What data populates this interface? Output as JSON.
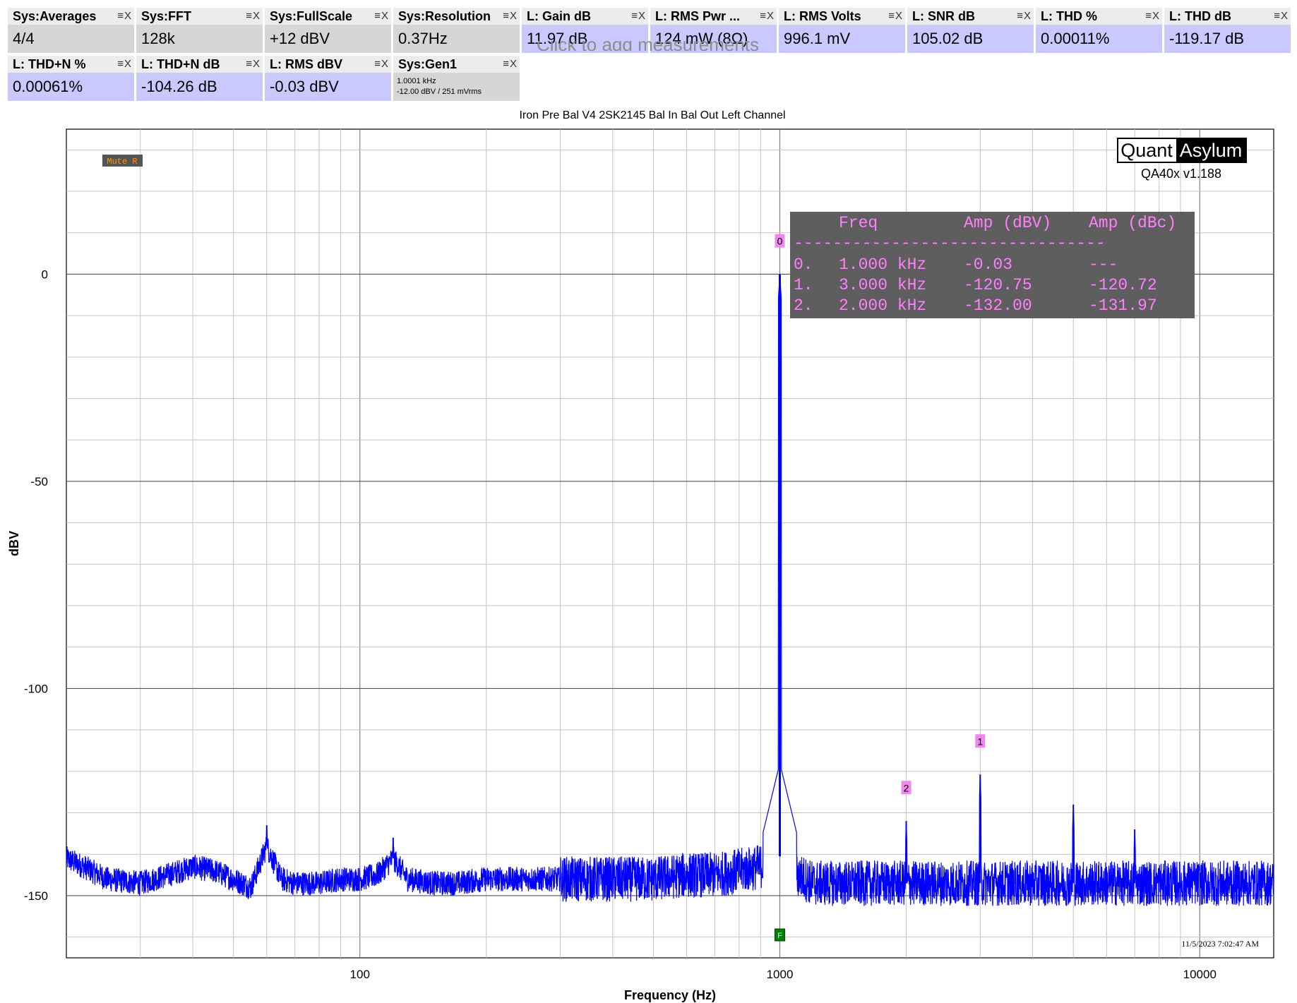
{
  "tiles": [
    {
      "label": "Sys:Averages",
      "value": "4/4",
      "style": "gray"
    },
    {
      "label": "Sys:FFT",
      "value": "128k",
      "style": "gray"
    },
    {
      "label": "Sys:FullScale",
      "value": "+12 dBV",
      "style": "gray"
    },
    {
      "label": "Sys:Resolution",
      "value": "0.37Hz",
      "style": "gray"
    },
    {
      "label": "L: Gain dB",
      "value": "11.97 dB",
      "style": "blue"
    },
    {
      "label": "L: RMS Pwr ...",
      "value": "124 mW (8Ω)",
      "style": "blue"
    },
    {
      "label": "L: RMS Volts",
      "value": "996.1 mV",
      "style": "blue"
    },
    {
      "label": "L: SNR dB",
      "value": "105.02 dB",
      "style": "blue"
    },
    {
      "label": "L: THD %",
      "value": "0.00011%",
      "style": "blue"
    },
    {
      "label": "L: THD dB",
      "value": "-119.17 dB",
      "style": "blue"
    },
    {
      "label": "L: THD+N %",
      "value": "0.00061%",
      "style": "blue"
    },
    {
      "label": "L: THD+N dB",
      "value": "-104.26 dB",
      "style": "blue"
    },
    {
      "label": "L: RMS dBV",
      "value": "-0.03 dBV",
      "style": "blue"
    },
    {
      "label": "Sys:Gen1",
      "sub1": "1.0001 kHz",
      "sub2": "-12.00 dBV  / 251 mVrms",
      "style": "gray"
    }
  ],
  "tile_controls": "≡X",
  "ghost_text": "Click to add measurements",
  "chart_data": {
    "type": "line",
    "title": "Iron Pre Bal V4 2SK2145 Bal In Bal Out Left Channel",
    "xlabel": "Frequency (Hz)",
    "ylabel": "dBV",
    "x_scale": "log",
    "xlim": [
      20,
      15000
    ],
    "ylim": [
      -165,
      35
    ],
    "x_ticks": [
      100,
      1000,
      10000
    ],
    "y_ticks": [
      0,
      -50,
      -100,
      -150
    ],
    "grid": true,
    "series": [
      {
        "color": "#0000ff",
        "noise_floor_points": [
          [
            20,
            -141
          ],
          [
            22,
            -143
          ],
          [
            25,
            -146
          ],
          [
            30,
            -147
          ],
          [
            35,
            -145
          ],
          [
            40,
            -143
          ],
          [
            45,
            -144
          ],
          [
            50,
            -146
          ],
          [
            55,
            -148
          ],
          [
            60,
            -138
          ],
          [
            65,
            -146
          ],
          [
            70,
            -147
          ],
          [
            80,
            -147
          ],
          [
            90,
            -146
          ],
          [
            100,
            -146
          ],
          [
            110,
            -145
          ],
          [
            120,
            -141
          ],
          [
            130,
            -146
          ],
          [
            150,
            -147
          ],
          [
            170,
            -147
          ],
          [
            200,
            -146
          ],
          [
            250,
            -146
          ],
          [
            300,
            -146
          ],
          [
            400,
            -146
          ],
          [
            500,
            -146
          ],
          [
            600,
            -145
          ],
          [
            700,
            -145
          ],
          [
            800,
            -144
          ],
          [
            900,
            -143
          ],
          [
            950,
            -140
          ],
          [
            1050,
            -141
          ],
          [
            1100,
            -145
          ],
          [
            1200,
            -147
          ],
          [
            1500,
            -147
          ],
          [
            2000,
            -147
          ],
          [
            3000,
            -147
          ],
          [
            5000,
            -147
          ],
          [
            8000,
            -147
          ],
          [
            12000,
            -147
          ],
          [
            15000,
            -147
          ]
        ],
        "spikes": [
          {
            "freq": 60,
            "dBV": -133
          },
          {
            "freq": 120,
            "dBV": -136
          },
          {
            "freq": 1000,
            "dBV": -0.03
          },
          {
            "freq": 2000,
            "dBV": -132.0
          },
          {
            "freq": 3000,
            "dBV": -120.75
          },
          {
            "freq": 5000,
            "dBV": -128
          },
          {
            "freq": 7000,
            "dBV": -134
          }
        ]
      }
    ],
    "markers": [
      {
        "label": "0",
        "freq": 1000,
        "dBV": -0.03
      },
      {
        "label": "1",
        "freq": 3000,
        "dBV": -120.75
      },
      {
        "label": "2",
        "freq": 2000,
        "dBV": -132.0
      }
    ],
    "fundamental_marker": "F",
    "badge": "Mute R",
    "logo": {
      "left": "Quant",
      "right": "Asylum"
    },
    "version": "QA40x v1.188",
    "timestamp": "11/5/2023 7:02:47 AM",
    "harmonics_table": {
      "headers": [
        "Freq",
        "Amp (dBV)",
        "Amp (dBc)"
      ],
      "separator": "--------------------------------",
      "rows": [
        [
          "0.",
          "1.000 kHz",
          "-0.03",
          "---"
        ],
        [
          "1.",
          "3.000 kHz",
          "-120.75",
          "-120.72"
        ],
        [
          "2.",
          "2.000 kHz",
          "-132.00",
          "-131.97"
        ]
      ]
    },
    "colors": {
      "trace": "#0000ff",
      "marker_bg": "#ee88ee",
      "table_bg": "#5e5e5e",
      "table_text": "#ff7fff",
      "badge_text": "#ff9900",
      "fundamental_bg": "#008000"
    }
  }
}
